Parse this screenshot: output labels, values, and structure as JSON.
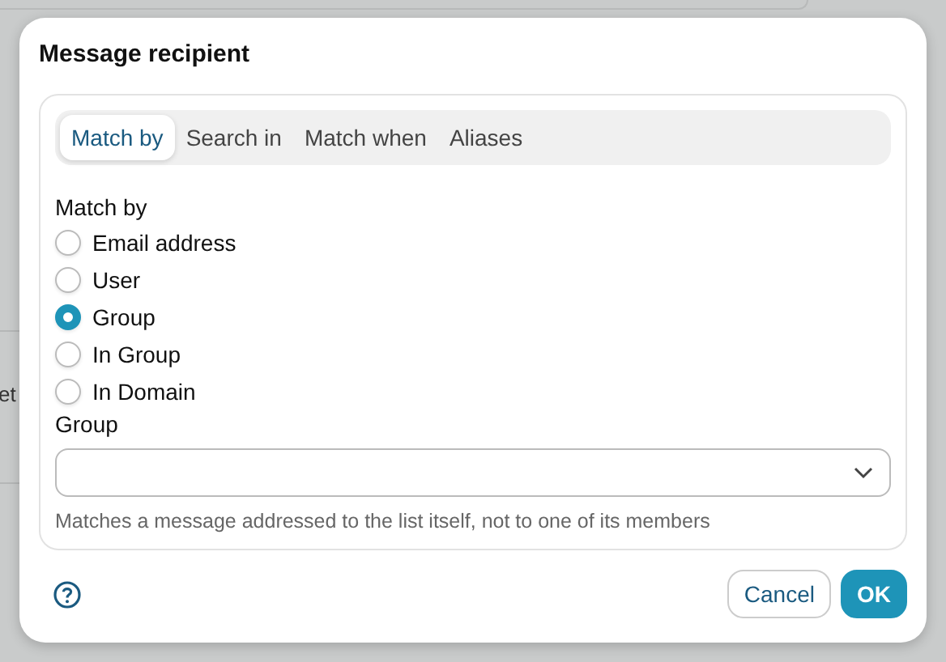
{
  "background": {
    "text_fragment": "et"
  },
  "dialog": {
    "title": "Message recipient",
    "tabs": [
      {
        "label": "Match by",
        "selected": true
      },
      {
        "label": "Search in",
        "selected": false
      },
      {
        "label": "Match when",
        "selected": false
      },
      {
        "label": "Aliases",
        "selected": false
      }
    ],
    "match_by": {
      "label": "Match by",
      "options": [
        {
          "label": "Email address",
          "selected": false
        },
        {
          "label": "User",
          "selected": false
        },
        {
          "label": "Group",
          "selected": true
        },
        {
          "label": "In Group",
          "selected": false
        },
        {
          "label": "In Domain",
          "selected": false
        }
      ]
    },
    "group": {
      "label": "Group",
      "help": "Matches a message addressed to the list itself, not to one of its members"
    },
    "buttons": [
      {
        "label": "Cancel",
        "kind": "secondary"
      },
      {
        "label": "OK",
        "kind": "primary"
      }
    ]
  }
}
